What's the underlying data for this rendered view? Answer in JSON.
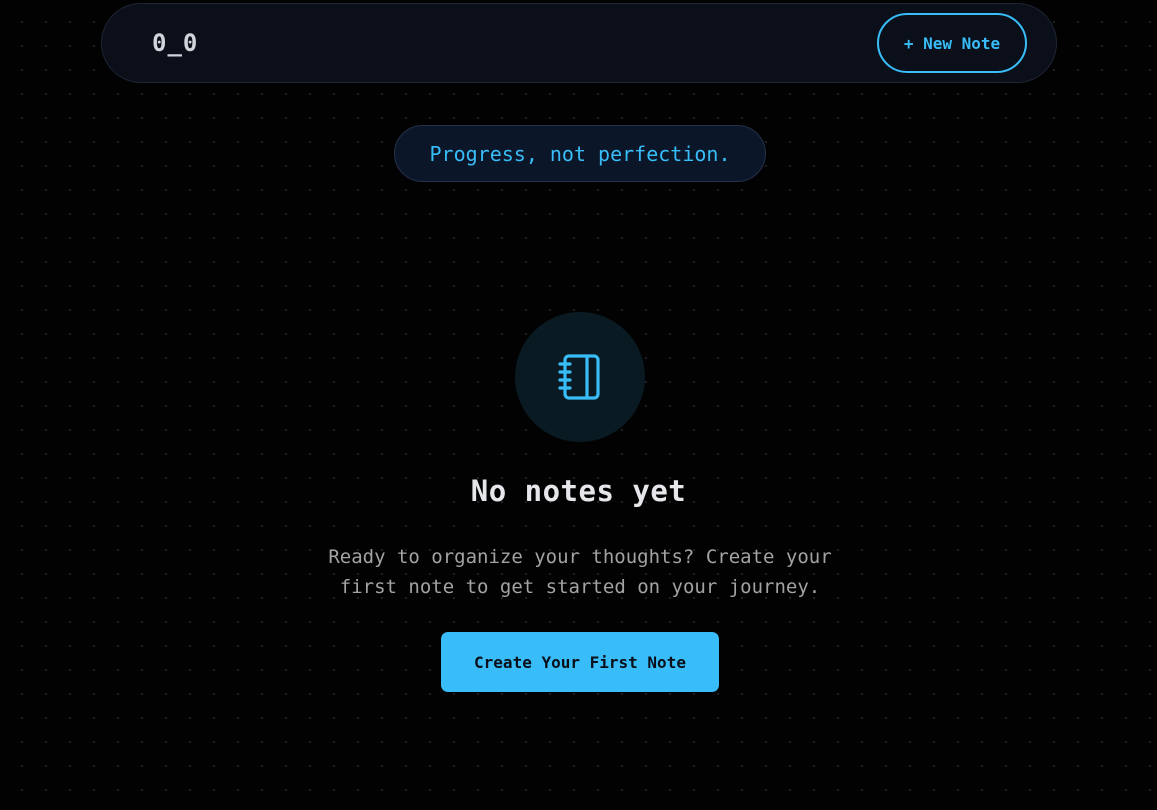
{
  "header": {
    "logo": "0_0",
    "new_note_label": "+ New Note"
  },
  "quote": "Progress, not perfection.",
  "empty_state": {
    "icon": "notebook-icon",
    "title": "No notes yet",
    "description": "Ready to organize your thoughts? Create your first note to get started on your journey.",
    "button_label": "Create Your First Note"
  },
  "colors": {
    "accent": "#38bdf8",
    "background": "#020203",
    "header_bg": "#0a0f1a"
  }
}
